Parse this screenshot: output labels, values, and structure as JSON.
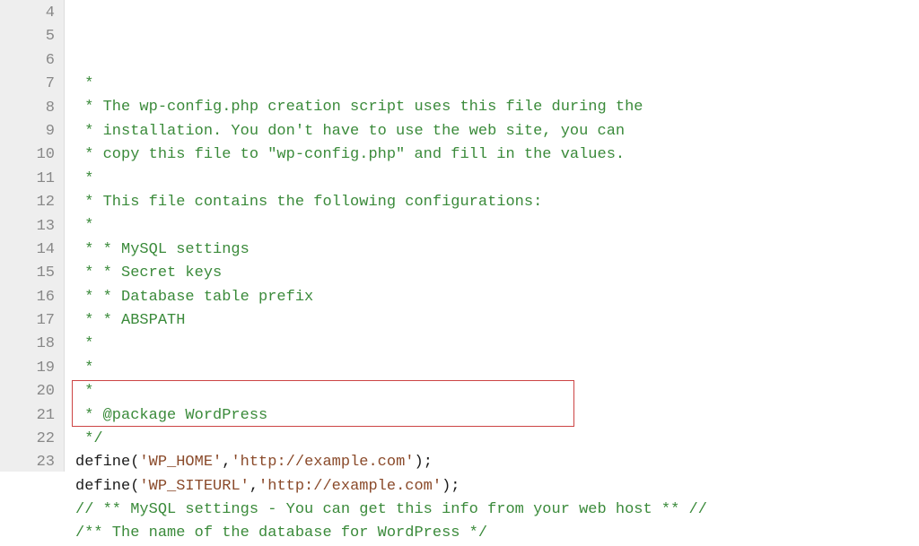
{
  "lines": [
    {
      "n": 4,
      "spans": [
        {
          "cls": "comment",
          "t": " *"
        }
      ]
    },
    {
      "n": 5,
      "spans": [
        {
          "cls": "comment",
          "t": " * The wp-config.php creation script uses this file during the"
        }
      ]
    },
    {
      "n": 6,
      "spans": [
        {
          "cls": "comment",
          "t": " * installation. You don't have to use the web site, you can"
        }
      ]
    },
    {
      "n": 7,
      "spans": [
        {
          "cls": "comment",
          "t": " * copy this file to \"wp-config.php\" and fill in the values."
        }
      ]
    },
    {
      "n": 8,
      "spans": [
        {
          "cls": "comment",
          "t": " *"
        }
      ]
    },
    {
      "n": 9,
      "spans": [
        {
          "cls": "comment",
          "t": " * This file contains the following configurations:"
        }
      ]
    },
    {
      "n": 10,
      "spans": [
        {
          "cls": "comment",
          "t": " *"
        }
      ]
    },
    {
      "n": 11,
      "spans": [
        {
          "cls": "comment",
          "t": " * * MySQL settings"
        }
      ]
    },
    {
      "n": 12,
      "spans": [
        {
          "cls": "comment",
          "t": " * * Secret keys"
        }
      ]
    },
    {
      "n": 13,
      "spans": [
        {
          "cls": "comment",
          "t": " * * Database table prefix"
        }
      ]
    },
    {
      "n": 14,
      "spans": [
        {
          "cls": "comment",
          "t": " * * ABSPATH"
        }
      ]
    },
    {
      "n": 15,
      "spans": [
        {
          "cls": "comment",
          "t": " *"
        }
      ]
    },
    {
      "n": 16,
      "spans": [
        {
          "cls": "comment",
          "t": " *"
        }
      ]
    },
    {
      "n": 17,
      "spans": [
        {
          "cls": "comment",
          "t": " *"
        }
      ]
    },
    {
      "n": 18,
      "spans": [
        {
          "cls": "comment",
          "t": " * @package WordPress"
        }
      ]
    },
    {
      "n": 19,
      "spans": [
        {
          "cls": "comment",
          "t": " */"
        }
      ]
    },
    {
      "n": 20,
      "spans": [
        {
          "cls": "func",
          "t": "define"
        },
        {
          "cls": "paren",
          "t": "("
        },
        {
          "cls": "string",
          "t": "'WP_HOME'"
        },
        {
          "cls": "paren",
          "t": ","
        },
        {
          "cls": "string",
          "t": "'http://example.com'"
        },
        {
          "cls": "paren",
          "t": ");"
        }
      ]
    },
    {
      "n": 21,
      "spans": [
        {
          "cls": "func",
          "t": "define"
        },
        {
          "cls": "paren",
          "t": "("
        },
        {
          "cls": "string",
          "t": "'WP_SITEURL'"
        },
        {
          "cls": "paren",
          "t": ","
        },
        {
          "cls": "string",
          "t": "'http://example.com'"
        },
        {
          "cls": "paren",
          "t": ");"
        }
      ]
    },
    {
      "n": 22,
      "spans": [
        {
          "cls": "comment",
          "t": "// ** MySQL settings - You can get this info from your web host ** //"
        }
      ]
    },
    {
      "n": 23,
      "spans": [
        {
          "cls": "comment",
          "t": "/** The name of the database for WordPress */"
        }
      ]
    }
  ]
}
